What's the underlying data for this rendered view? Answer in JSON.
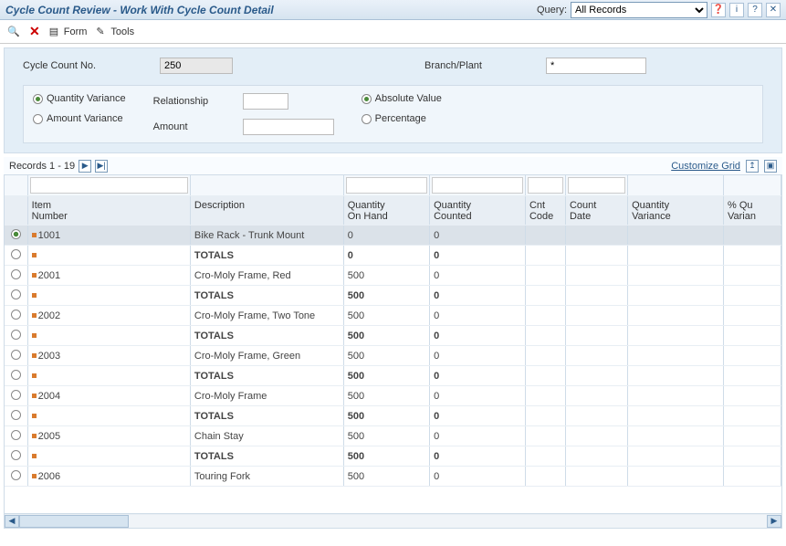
{
  "header": {
    "title": "Cycle Count Review - Work With Cycle Count Detail",
    "query_label": "Query:",
    "query_value": "All Records"
  },
  "toolbar": {
    "form_label": "Form",
    "tools_label": "Tools"
  },
  "form": {
    "cycle_count_label": "Cycle Count No.",
    "cycle_count_value": "250",
    "branch_label": "Branch/Plant",
    "branch_value": "*",
    "qty_variance_label": "Quantity Variance",
    "amt_variance_label": "Amount Variance",
    "relationship_label": "Relationship",
    "amount_label": "Amount",
    "absolute_label": "Absolute Value",
    "percentage_label": "Percentage"
  },
  "grid_bar": {
    "records_text": "Records 1 - 19",
    "customize": "Customize Grid"
  },
  "columns": {
    "item": "Item\nNumber",
    "desc": "Description",
    "qoh": "Quantity\nOn Hand",
    "qc": "Quantity\nCounted",
    "cnt": "Cnt\nCode",
    "cdate": "Count\nDate",
    "qvar": "Quantity\nVariance",
    "pqvar": "% Qu\nVarian"
  },
  "rows": [
    {
      "sel": true,
      "marker": true,
      "item": "1001",
      "desc": "Bike Rack - Trunk Mount",
      "qoh": "0",
      "qc": "0",
      "total": false
    },
    {
      "sel": false,
      "marker": true,
      "item": "",
      "desc": "TOTALS",
      "qoh": "0",
      "qc": "0",
      "total": true
    },
    {
      "sel": false,
      "marker": true,
      "item": "2001",
      "desc": "Cro-Moly Frame, Red",
      "qoh": "500",
      "qc": "0",
      "total": false
    },
    {
      "sel": false,
      "marker": true,
      "item": "",
      "desc": "TOTALS",
      "qoh": "500",
      "qc": "0",
      "total": true
    },
    {
      "sel": false,
      "marker": true,
      "item": "2002",
      "desc": "Cro-Moly Frame, Two Tone",
      "qoh": "500",
      "qc": "0",
      "total": false
    },
    {
      "sel": false,
      "marker": true,
      "item": "",
      "desc": "TOTALS",
      "qoh": "500",
      "qc": "0",
      "total": true
    },
    {
      "sel": false,
      "marker": true,
      "item": "2003",
      "desc": "Cro-Moly Frame, Green",
      "qoh": "500",
      "qc": "0",
      "total": false
    },
    {
      "sel": false,
      "marker": true,
      "item": "",
      "desc": "TOTALS",
      "qoh": "500",
      "qc": "0",
      "total": true
    },
    {
      "sel": false,
      "marker": true,
      "item": "2004",
      "desc": "Cro-Moly Frame",
      "qoh": "500",
      "qc": "0",
      "total": false
    },
    {
      "sel": false,
      "marker": true,
      "item": "",
      "desc": "TOTALS",
      "qoh": "500",
      "qc": "0",
      "total": true
    },
    {
      "sel": false,
      "marker": true,
      "item": "2005",
      "desc": "Chain Stay",
      "qoh": "500",
      "qc": "0",
      "total": false
    },
    {
      "sel": false,
      "marker": true,
      "item": "",
      "desc": "TOTALS",
      "qoh": "500",
      "qc": "0",
      "total": true
    },
    {
      "sel": false,
      "marker": true,
      "item": "2006",
      "desc": "Touring Fork",
      "qoh": "500",
      "qc": "0",
      "total": false
    }
  ]
}
